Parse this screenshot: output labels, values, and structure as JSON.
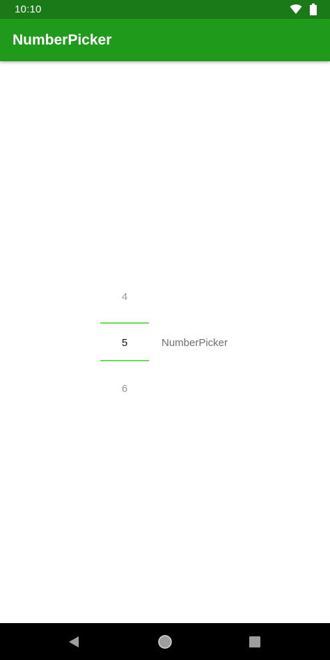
{
  "status_bar": {
    "time": "10:10",
    "icons": [
      "wifi-icon",
      "battery-icon"
    ]
  },
  "app_bar": {
    "title": "NumberPicker",
    "color": "#209a1b"
  },
  "number_picker": {
    "previous_value": "4",
    "selected_value": "5",
    "next_value": "6",
    "divider_color": "#6ad95c",
    "label": "NumberPicker"
  },
  "nav_bar": {
    "buttons": [
      "back-icon",
      "home-icon",
      "recents-icon"
    ]
  }
}
